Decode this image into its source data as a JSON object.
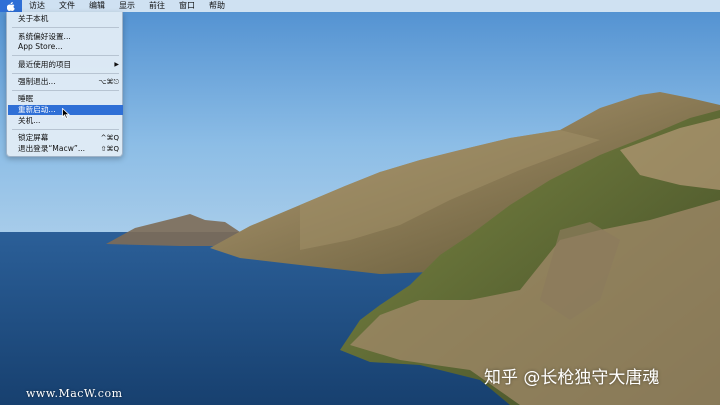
{
  "menubar": {
    "items": [
      "访达",
      "文件",
      "编辑",
      "显示",
      "前往",
      "窗口",
      "帮助"
    ]
  },
  "apple_menu": {
    "about": "关于本机",
    "system_prefs": "系统偏好设置...",
    "app_store": "App Store...",
    "recent_items": "最近使用的项目",
    "recent_items_arrow": "▶",
    "force_quit": "强制退出...",
    "force_quit_shortcut": "⌥⌘⎋",
    "sleep": "睡眠",
    "restart": "重新启动...",
    "shutdown": "关机...",
    "lock_screen": "锁定屏幕",
    "lock_screen_shortcut": "^⌘Q",
    "logout": "退出登录“Macw”...",
    "logout_shortcut": "⇧⌘Q"
  },
  "watermarks": {
    "left": "www.MacW.com",
    "right": "知乎 @长枪独守大唐魂"
  },
  "colors": {
    "highlight": "#2f6fd6",
    "sky": "#6aa4d6",
    "sea": "#1f4f86"
  }
}
